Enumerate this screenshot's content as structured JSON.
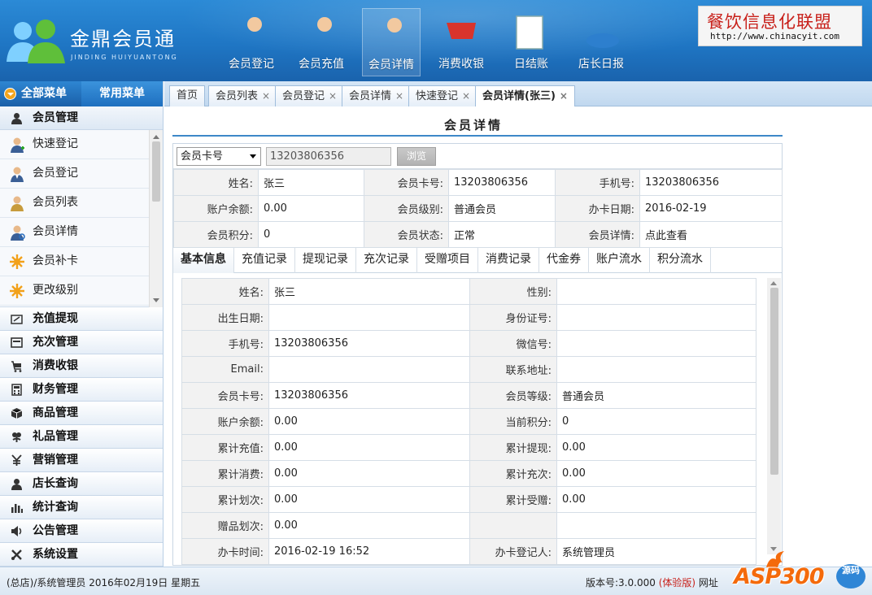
{
  "logo": {
    "title": "金鼎会员通",
    "subtitle": "JINDING HUIYUANTONG"
  },
  "topnav": [
    {
      "label": "会员登记",
      "icon": "user-add-icon"
    },
    {
      "label": "会员充值",
      "icon": "user-recharge-icon"
    },
    {
      "label": "会员详情",
      "icon": "user-search-icon",
      "active": true
    },
    {
      "label": "消费收银",
      "icon": "shopping-cart-icon"
    },
    {
      "label": "日结账",
      "icon": "notepad-icon"
    },
    {
      "label": "店长日报",
      "icon": "pie-chart-icon"
    }
  ],
  "brand": {
    "name": "餐饮信息化联盟",
    "url": "http://www.chinacyit.com"
  },
  "sidebar": {
    "tab_all": "全部菜单",
    "tab_common": "常用菜单",
    "member_group": "会员管理",
    "sub_items": [
      "快速登记",
      "会员登记",
      "会员列表",
      "会员详情",
      "会员补卡",
      "更改级别"
    ],
    "groups": [
      {
        "label": "充值提现",
        "icon": "recharge-icon"
      },
      {
        "label": "充次管理",
        "icon": "card-icon"
      },
      {
        "label": "消费收银",
        "icon": "cart-icon"
      },
      {
        "label": "财务管理",
        "icon": "calculator-icon"
      },
      {
        "label": "商品管理",
        "icon": "box-icon"
      },
      {
        "label": "礼品管理",
        "icon": "gift-icon"
      },
      {
        "label": "营销管理",
        "icon": "yen-icon"
      },
      {
        "label": "店长查询",
        "icon": "manager-icon"
      },
      {
        "label": "统计查询",
        "icon": "bar-chart-icon"
      },
      {
        "label": "公告管理",
        "icon": "speaker-icon"
      },
      {
        "label": "系统设置",
        "icon": "tools-icon"
      }
    ]
  },
  "tabs": [
    {
      "label": "首页",
      "closable": false
    },
    {
      "label": "会员列表",
      "closable": true
    },
    {
      "label": "会员登记",
      "closable": true
    },
    {
      "label": "会员详情",
      "closable": true
    },
    {
      "label": "快速登记",
      "closable": true
    },
    {
      "label": "会员详情(张三)",
      "closable": true,
      "active": true
    }
  ],
  "close_glyph": "×",
  "page_title": "会员详情",
  "search": {
    "select_value": "会员卡号",
    "card_number": "13203806356",
    "browse_label": "浏览"
  },
  "summary": [
    [
      [
        "姓名:",
        "张三"
      ],
      [
        "会员卡号:",
        "13203806356"
      ],
      [
        "手机号:",
        "13203806356"
      ]
    ],
    [
      [
        "账户余额:",
        "0.00"
      ],
      [
        "会员级别:",
        "普通会员"
      ],
      [
        "办卡日期:",
        "2016-02-19"
      ]
    ],
    [
      [
        "会员积分:",
        "0"
      ],
      [
        "会员状态:",
        "正常"
      ],
      [
        "会员详情:",
        "点此查看"
      ]
    ]
  ],
  "subtabs": [
    "基本信息",
    "充值记录",
    "提现记录",
    "充次记录",
    "受赠项目",
    "消费记录",
    "代金券",
    "账户流水",
    "积分流水"
  ],
  "detail": [
    [
      [
        "姓名:",
        "张三"
      ],
      [
        "性别:",
        ""
      ]
    ],
    [
      [
        "出生日期:",
        ""
      ],
      [
        "身份证号:",
        ""
      ]
    ],
    [
      [
        "手机号:",
        "13203806356"
      ],
      [
        "微信号:",
        ""
      ]
    ],
    [
      [
        "Email:",
        ""
      ],
      [
        "联系地址:",
        ""
      ]
    ],
    [
      [
        "会员卡号:",
        "13203806356"
      ],
      [
        "会员等级:",
        "普通会员"
      ]
    ],
    [
      [
        "账户余额:",
        "0.00"
      ],
      [
        "当前积分:",
        "0"
      ]
    ],
    [
      [
        "累计充值:",
        "0.00"
      ],
      [
        "累计提现:",
        "0.00"
      ]
    ],
    [
      [
        "累计消费:",
        "0.00"
      ],
      [
        "累计充次:",
        "0.00"
      ]
    ],
    [
      [
        "累计划次:",
        "0.00"
      ],
      [
        "累计受赠:",
        "0.00"
      ]
    ],
    [
      [
        "赠品划次:",
        "0.00"
      ],
      [
        "",
        ""
      ]
    ],
    [
      [
        "办卡时间:",
        "2016-02-19 16:52"
      ],
      [
        "办卡登记人:",
        "系统管理员"
      ]
    ]
  ],
  "footer": {
    "left": "(总店)/系统管理员   2016年02月19日   星期五",
    "version_label": "版本号:3.0.000",
    "edition": "(体验版)",
    "site_label": "网址"
  },
  "watermark": {
    "text": "ASP300",
    "badge": "源码"
  },
  "colors": {
    "header_blue": "#1f76c4",
    "accent_red": "#c8201a",
    "watermark_orange": "#f46a0b"
  }
}
